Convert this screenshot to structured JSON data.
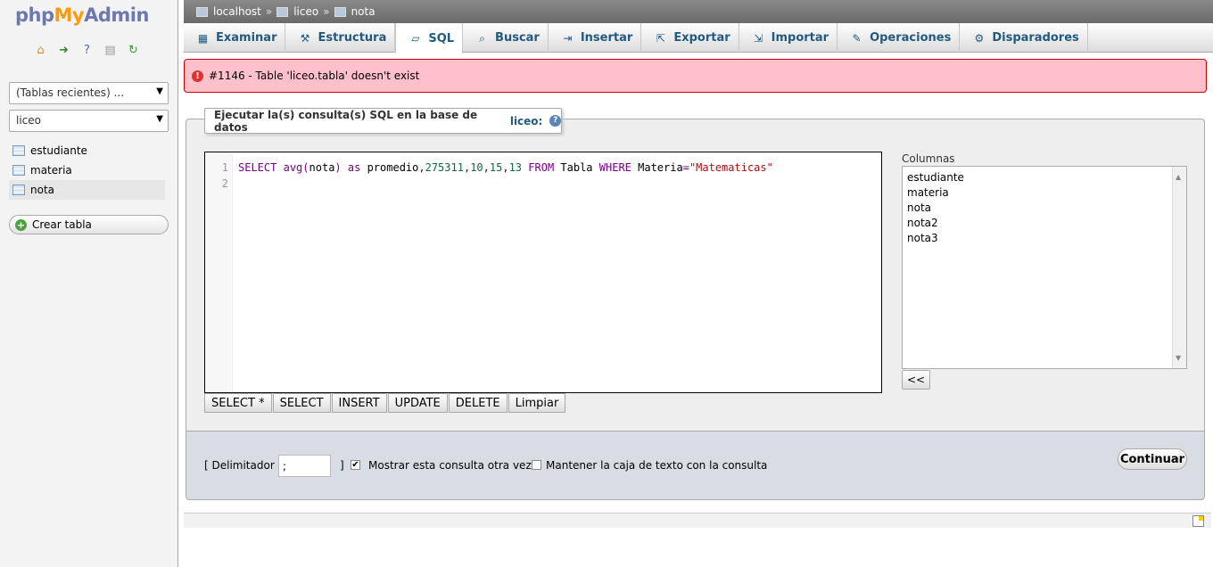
{
  "logo": {
    "php": "php",
    "my": "My",
    "admin": "Admin"
  },
  "quicklinks": [
    {
      "icon": "home-icon",
      "glyph": "⌂",
      "color": "#c8922a"
    },
    {
      "icon": "logout-icon",
      "glyph": "➜",
      "color": "#3a8a3a"
    },
    {
      "icon": "help-icon",
      "glyph": "?",
      "color": "#4a6fa5"
    },
    {
      "icon": "docs-icon",
      "glyph": "▤",
      "color": "#999999"
    },
    {
      "icon": "reload-icon",
      "glyph": "↻",
      "color": "#3a9a3a"
    }
  ],
  "sidebar": {
    "recent": "(Tablas recientes) ...",
    "database": "liceo",
    "tables": [
      "estudiante",
      "materia",
      "nota"
    ],
    "active_table": "nota",
    "new_table": "Crear tabla"
  },
  "breadcrumb": {
    "server": "localhost",
    "db": "liceo",
    "table": "nota",
    "sep": "»"
  },
  "tabs": [
    {
      "label": "Examinar",
      "icon": "browse-icon",
      "glyph": "▦"
    },
    {
      "label": "Estructura",
      "icon": "structure-icon",
      "glyph": "⚒"
    },
    {
      "label": "SQL",
      "icon": "sql-icon",
      "glyph": "▱"
    },
    {
      "label": "Buscar",
      "icon": "search-icon",
      "glyph": "🔍"
    },
    {
      "label": "Insertar",
      "icon": "insert-icon",
      "glyph": "⇥"
    },
    {
      "label": "Exportar",
      "icon": "export-icon",
      "glyph": "⇱"
    },
    {
      "label": "Importar",
      "icon": "import-icon",
      "glyph": "⇲"
    },
    {
      "label": "Operaciones",
      "icon": "wrench-icon",
      "glyph": "🔧"
    },
    {
      "label": "Disparadores",
      "icon": "triggers-icon",
      "glyph": "⚙"
    }
  ],
  "active_tab": "SQL",
  "error": {
    "text": "#1146 - Table 'liceo.tabla' doesn't exist"
  },
  "query_box": {
    "legend": "Ejecutar la(s) consulta(s) SQL en la base de datos",
    "database": "liceo:"
  },
  "sql": {
    "line_numbers": [
      "1",
      "2"
    ],
    "select": "SELECT",
    "func": "avg",
    "open": "(",
    "arg": "nota",
    "close": ")",
    "as": "as",
    "alias": "promedio",
    "c1": ",",
    "n1": "275311",
    "c2": ",",
    "n2": "10",
    "c3": ",",
    "n3": "15",
    "c4": ",",
    "n4": "13",
    "from": "FROM",
    "table": "Tabla",
    "where": "WHERE",
    "col": "Materia",
    "eq": "=",
    "str": "\"Matematicas\""
  },
  "sql_buttons": [
    "SELECT *",
    "SELECT",
    "INSERT",
    "UPDATE",
    "DELETE",
    "Limpiar"
  ],
  "columns": {
    "label": "Columnas",
    "items": [
      "estudiante",
      "materia",
      "nota",
      "nota2",
      "nota3"
    ],
    "insert_button": "<<"
  },
  "options": {
    "delimiter_label": "[ Delimitador",
    "delimiter_value": ";",
    "delimiter_close": "]",
    "show_query_label": "Mostrar esta consulta otra vez",
    "show_query_checked": true,
    "keep_box_label": "Mantener la caja de texto con la consulta",
    "keep_box_checked": false,
    "go_button": "Continuar"
  }
}
